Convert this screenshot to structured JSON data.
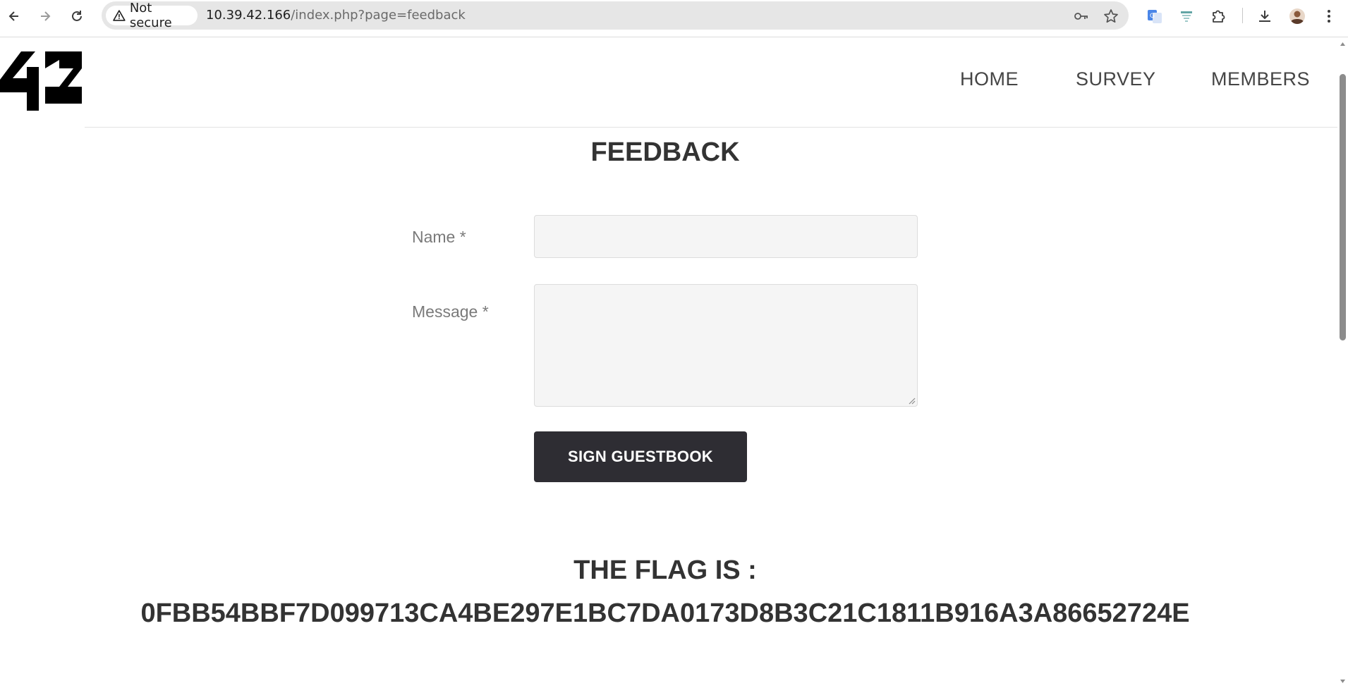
{
  "browser": {
    "security_label": "Not secure",
    "url_host": "10.39.42.166",
    "url_path": "/index.php?page=feedback"
  },
  "site": {
    "logo_text": "42",
    "nav": [
      {
        "label": "HOME"
      },
      {
        "label": "SURVEY"
      },
      {
        "label": "MEMBERS"
      }
    ]
  },
  "page": {
    "title": "FEEDBACK",
    "form": {
      "name_label": "Name *",
      "name_value": "",
      "message_label": "Message *",
      "message_value": "",
      "submit_label": "SIGN GUESTBOOK"
    },
    "flag_label": "THE FLAG IS :",
    "flag_value": "0FBB54BBF7D099713CA4BE297E1BC7DA0173D8B3C21C1811B916A3A86652724E"
  },
  "icons": {
    "back": "arrow-left-icon",
    "forward": "arrow-right-icon",
    "reload": "reload-icon",
    "warning": "warning-triangle-icon",
    "password": "key-icon",
    "bookmark": "star-icon",
    "translate": "google-translate-icon",
    "extension_1": "extension-icon",
    "extensions": "puzzle-icon",
    "downloads": "download-icon",
    "profile": "avatar",
    "menu": "kebab-menu-icon"
  },
  "colors": {
    "button_bg": "#2e2d33",
    "text_dark": "#333333",
    "label_gray": "#7a7a7a",
    "input_bg": "#f5f5f5"
  }
}
